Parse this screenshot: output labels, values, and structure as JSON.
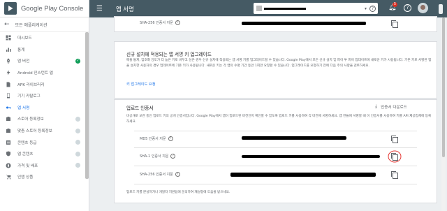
{
  "brand": {
    "title": "Google Play Console"
  },
  "sidebar": {
    "back_label": "모든 애플리케이션",
    "items": [
      {
        "label": "대시보드",
        "icon": "dashboard-icon",
        "status": ""
      },
      {
        "label": "통계",
        "icon": "stats-icon",
        "status": ""
      },
      {
        "label": "앱 버전",
        "icon": "rocket-icon",
        "status": "done"
      },
      {
        "label": "Android 인스턴트 앱",
        "icon": "instant-app-icon",
        "status": ""
      },
      {
        "label": "APK 라이브러리",
        "icon": "apk-icon",
        "status": ""
      },
      {
        "label": "기기 카탈로그",
        "icon": "device-icon",
        "status": ""
      },
      {
        "label": "앱 서명",
        "icon": "key-icon",
        "status": "",
        "active": true
      },
      {
        "label": "스토어 등록정보",
        "icon": "store-listing-icon",
        "status": "pending"
      },
      {
        "label": "맞춤 스토어 등록정보",
        "icon": "custom-store-icon",
        "status": "pending"
      },
      {
        "label": "콘텐츠 등급",
        "icon": "rating-icon",
        "status": "pending"
      },
      {
        "label": "앱 콘텐츠",
        "icon": "shield-icon",
        "status": "pending"
      },
      {
        "label": "가격 및 배포",
        "icon": "globe-icon",
        "status": "pending"
      },
      {
        "label": "인앱 상품",
        "icon": "cart-icon",
        "status": ""
      }
    ]
  },
  "topbar": {
    "menu_icon": "menu-icon",
    "title": "앱 서명",
    "help_glyph": "?",
    "notification_count": "5"
  },
  "section_top": {
    "sha256_label": "SHA-256 인증서 지문"
  },
  "upgrade_card": {
    "title": "신규 설치에 적용되는 앱 서명 키 업그레이드",
    "body": "매출 통계, 암호화 강도가 더 높은 키로 바꾸고 싶은 경우 신규 설치에 적용되는 앱 서명 키를 업그레이드할 수 있습니다. Google Play에서 모든 신규 설치 및 피어 투 피어 업데이트에 새로운 키가 사용됩니다. 기존 키로 서명된 앱을 설치한 사용자의 경우 업데이트에 기존 키가 사용됩니다. 새로운 키는 각 앱의 수명 기간 동안 1회만 요청할 수 있습니다. 업그레이드를 요청하기 전에 다음 주의 사항을 검토하세요.",
    "link": "키 업그레이드 요청"
  },
  "upload_card": {
    "title": "업로드 인증서",
    "download_label": "인증서 다운로드",
    "body": "비공개로 보관 중인 업로드 키의 공개 인증서입니다. Google Play에서 앱이 업로드된 버전인지 확인할 수 있도록 업로드 키를 사용하여 각 버전에 서명하세요. 앱 번들에 서명할 때 이 인증서를 사용하여 키를 API 제공업체에 등록하세요.",
    "rows": [
      {
        "label": "MD5 인증서 지문"
      },
      {
        "label": "SHA-1 인증서 지문"
      },
      {
        "label": "SHA-256 인증서 지문"
      }
    ],
    "footer": "업로드 키를 분실하거나 개발자 지원팀에 문의하여 재설정에 도움을 받으세요."
  },
  "colors": {
    "topbar": "#455a64",
    "accent": "#1a73e8",
    "success": "#0f9d58",
    "annotation": "#e53935"
  }
}
